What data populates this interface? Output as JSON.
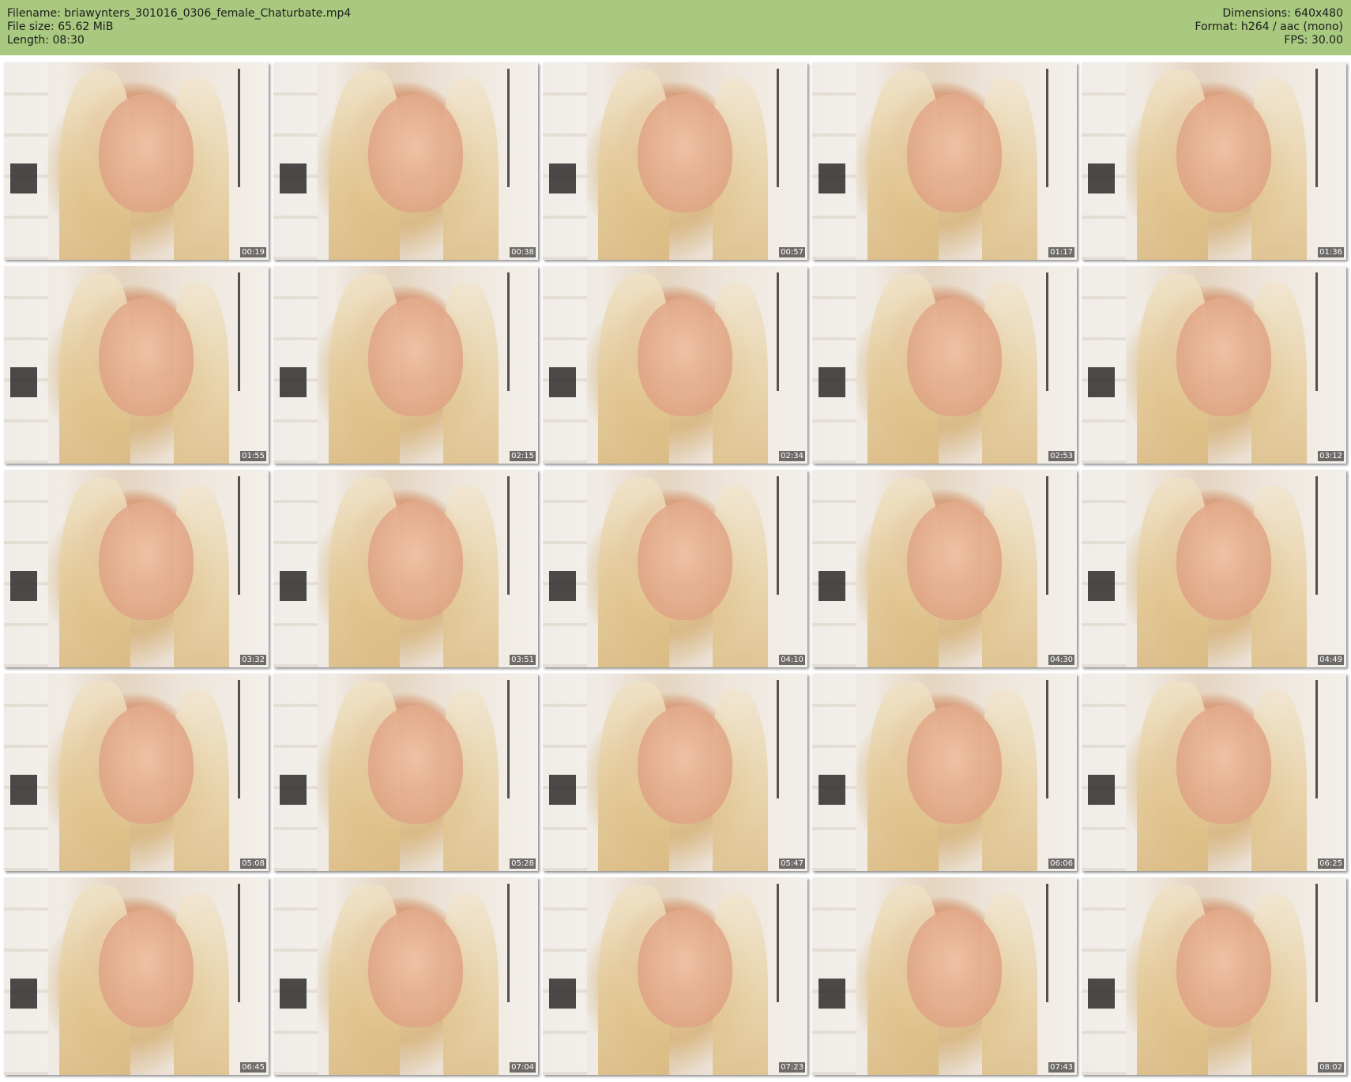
{
  "header": {
    "filename": "Filename: briawynters_301016_0306_female_Chaturbate.mp4",
    "filesize": "File size: 65.62 MiB",
    "length": "Length: 08:30",
    "dimensions": "Dimensions: 640x480",
    "format": "Format: h264 / aac (mono)",
    "fps": "FPS: 30.00"
  },
  "thumbnails": [
    {
      "timestamp": "00:19"
    },
    {
      "timestamp": "00:38"
    },
    {
      "timestamp": "00:57"
    },
    {
      "timestamp": "01:17"
    },
    {
      "timestamp": "01:36"
    },
    {
      "timestamp": "01:55"
    },
    {
      "timestamp": "02:15"
    },
    {
      "timestamp": "02:34"
    },
    {
      "timestamp": "02:53"
    },
    {
      "timestamp": "03:12"
    },
    {
      "timestamp": "03:32"
    },
    {
      "timestamp": "03:51"
    },
    {
      "timestamp": "04:10"
    },
    {
      "timestamp": "04:30"
    },
    {
      "timestamp": "04:49"
    },
    {
      "timestamp": "05:08"
    },
    {
      "timestamp": "05:28"
    },
    {
      "timestamp": "05:47"
    },
    {
      "timestamp": "06:06"
    },
    {
      "timestamp": "06:25"
    },
    {
      "timestamp": "06:45"
    },
    {
      "timestamp": "07:04"
    },
    {
      "timestamp": "07:23"
    },
    {
      "timestamp": "07:43"
    },
    {
      "timestamp": "08:02"
    }
  ]
}
